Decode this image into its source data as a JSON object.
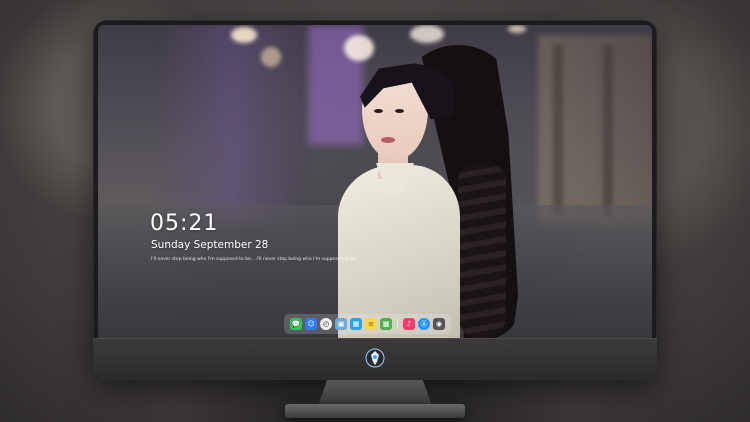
{
  "lock_screen": {
    "time": "05:21",
    "date": "Sunday September  28",
    "quote": "I'll never stop being who I'm supposed to be... I'll never stop being who I'm supposed to be"
  },
  "dock": {
    "apps": [
      {
        "name": "messages",
        "glyph": "💬",
        "color": "#34c759"
      },
      {
        "name": "finder",
        "glyph": "☺",
        "color": "#2e7bf6"
      },
      {
        "name": "clock",
        "glyph": "◴",
        "color": "#f2f2f2"
      },
      {
        "name": "preview",
        "glyph": "▣",
        "color": "#6fa8dc"
      },
      {
        "name": "photo-booth",
        "glyph": "▦",
        "color": "#2aa3e8"
      },
      {
        "name": "notes",
        "glyph": "≡",
        "color": "#ffd54a"
      },
      {
        "name": "photos",
        "glyph": "▩",
        "color": "#4caf50"
      },
      {
        "name": "music",
        "glyph": "♪",
        "color": "#fc3c6e"
      },
      {
        "name": "app-store",
        "glyph": "Ⓐ",
        "color": "#1e90ff"
      },
      {
        "name": "camera",
        "glyph": "◉",
        "color": "#555555"
      }
    ]
  },
  "colors": {
    "monitor_body": "#1b1b1d",
    "chin": "#3c3a3b",
    "text": "#ffffff"
  }
}
